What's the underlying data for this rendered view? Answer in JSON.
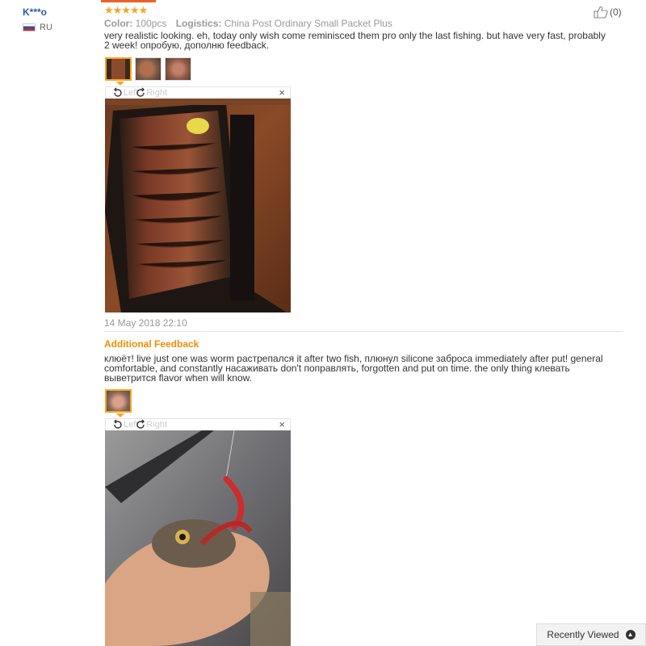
{
  "reviewer": {
    "name": "K***o",
    "country": "RU"
  },
  "review": {
    "stars": "★★★★★",
    "color_label": "Color:",
    "color_value": "100pcs",
    "logistics_label": "Logistics:",
    "logistics_value": "China Post Ordinary Small Packet Plus",
    "text": "very realistic looking. eh, today only wish come reminisced them pro only the last fishing. but have very fast, probably 2 week! опробую, дополню feedback.",
    "date": "14 May 2018 22:10",
    "helpful_count": "(0)"
  },
  "viewer": {
    "rotate_left": "Left",
    "rotate_right": "Right",
    "close": "×"
  },
  "additional": {
    "title": "Additional Feedback",
    "text": "клюёт! live just one was worm растрепался it after two fish, плюнул silicone заброса immediately after put! general comfortable, and constantly насаживать don't поправлять, forgotten and put on time. the only thing клевать выветрится flavor when will know."
  },
  "footer": {
    "recently_viewed": "Recently Viewed"
  },
  "icons": [
    "thumbs-up-icon",
    "rotate-left-icon",
    "rotate-right-icon",
    "close-icon",
    "chevron-up-icon",
    "flag-icon"
  ]
}
